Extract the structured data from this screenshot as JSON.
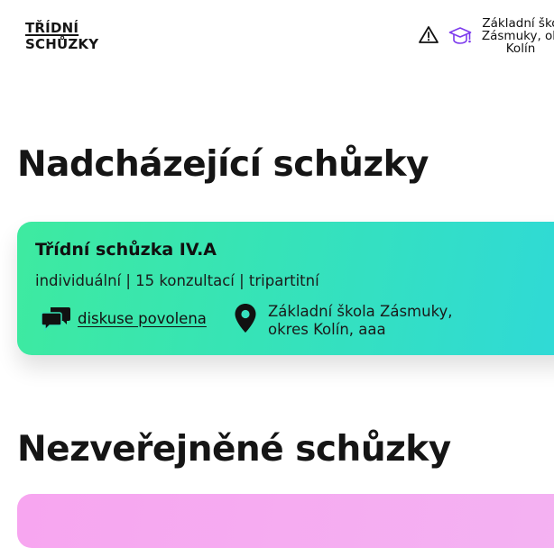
{
  "header": {
    "logo_line1": "TŘÍDNÍ",
    "logo_line2": "SCHŮZKY",
    "warning_icon": "warning-triangle-icon",
    "school_icon": "graduation-cap-icon",
    "school_line1": "Základní ško",
    "school_line2": "Zásmuky, ok",
    "school_line3": "Kolín",
    "colors": {
      "cap": "#7c3aed"
    }
  },
  "sections": {
    "upcoming_title": "Nadcházející schůzky",
    "unpublished_title": "Nezveřejněné schůzky"
  },
  "meeting": {
    "title": "Třídní schůzka IV.A",
    "meta": "individuální | 15 konzultací | tripartitní",
    "discussion_icon": "chat-bubbles-icon",
    "discussion_label": "diskuse povolena",
    "location_icon": "map-pin-icon",
    "address_line1": "Základní škola Zásmuky,",
    "address_line2": "okres Kolín, aaa",
    "colors": {
      "gradient_start": "#3eeaa0",
      "gradient_end": "#2fd9d8"
    }
  },
  "unpublished_card": {
    "colors": {
      "background": "#f7a6f0"
    }
  }
}
